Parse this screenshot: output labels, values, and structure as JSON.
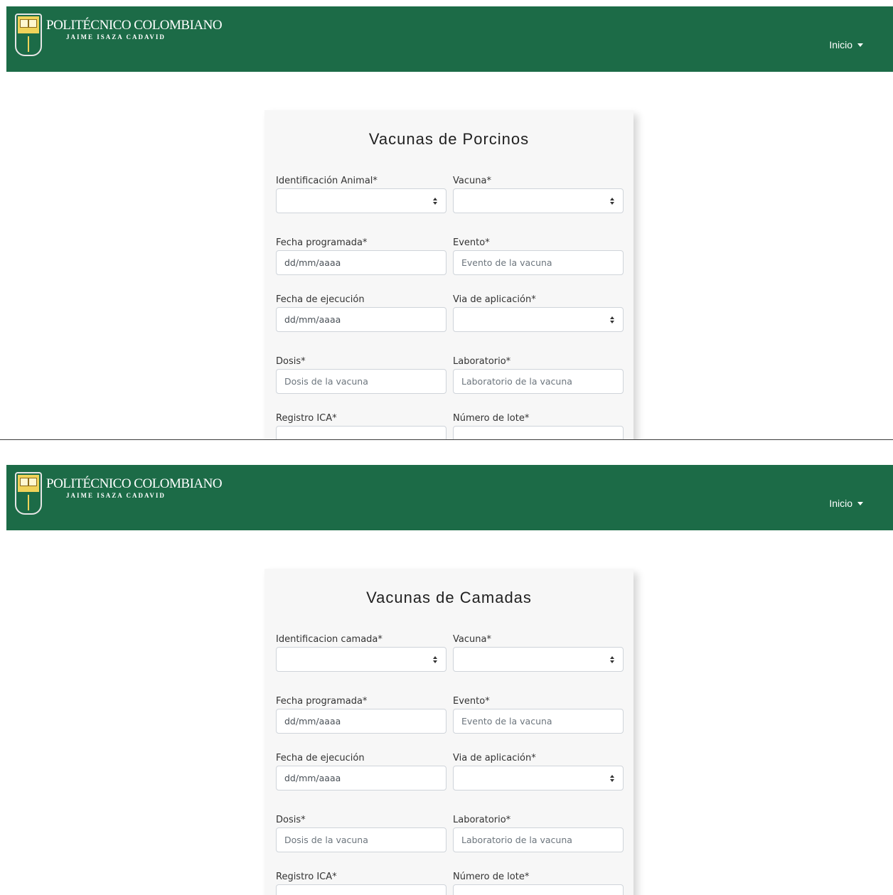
{
  "screens": [
    {
      "brand": {
        "name": "POLITÉCNICO COLOMBIANO",
        "sub": "JAIME ISAZA CADAVID"
      },
      "nav": {
        "inicio": "Inicio"
      },
      "form": {
        "title": "Vacunas de Porcinos",
        "fields": {
          "id": {
            "label": "Identificación Animal*"
          },
          "vacuna": {
            "label": "Vacuna*"
          },
          "fecha_prog": {
            "label": "Fecha programada*",
            "value": "dd/mm/aaaa"
          },
          "evento": {
            "label": "Evento*",
            "placeholder": "Evento de la vacuna"
          },
          "fecha_ejec": {
            "label": "Fecha de ejecución",
            "value": "dd/mm/aaaa"
          },
          "via": {
            "label": "Via de aplicación*"
          },
          "dosis": {
            "label": "Dosis*",
            "placeholder": "Dosis de la vacuna"
          },
          "laboratorio": {
            "label": "Laboratorio*",
            "placeholder": "Laboratorio de la vacuna"
          },
          "registro": {
            "label": "Registro ICA*"
          },
          "lote": {
            "label": "Número de lote*"
          }
        }
      }
    },
    {
      "brand": {
        "name": "POLITÉCNICO COLOMBIANO",
        "sub": "JAIME ISAZA CADAVID"
      },
      "nav": {
        "inicio": "Inicio"
      },
      "form": {
        "title": "Vacunas de Camadas",
        "fields": {
          "id": {
            "label": "Identificacion camada*"
          },
          "vacuna": {
            "label": "Vacuna*"
          },
          "fecha_prog": {
            "label": "Fecha programada*",
            "value": "dd/mm/aaaa"
          },
          "evento": {
            "label": "Evento*",
            "placeholder": "Evento de la vacuna"
          },
          "fecha_ejec": {
            "label": "Fecha de ejecución",
            "value": "dd/mm/aaaa"
          },
          "via": {
            "label": "Via de aplicación*"
          },
          "dosis": {
            "label": "Dosis*",
            "placeholder": "Dosis de la vacuna"
          },
          "laboratorio": {
            "label": "Laboratorio*",
            "placeholder": "Laboratorio de la vacuna"
          },
          "registro": {
            "label": "Registro ICA*"
          },
          "lote": {
            "label": "Número de lote*"
          }
        }
      }
    }
  ]
}
